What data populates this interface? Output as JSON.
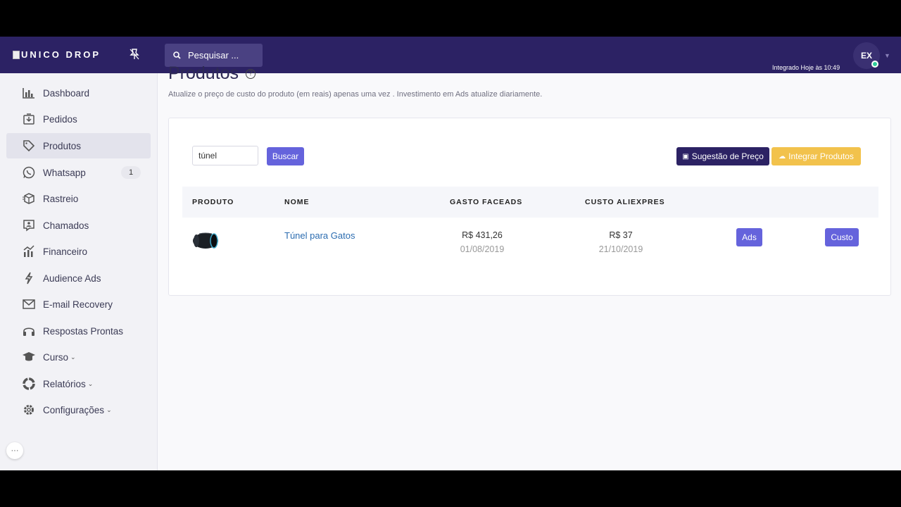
{
  "topbar": {
    "brand": "UNICO DROP",
    "search_placeholder": "Pesquisar ...",
    "integrado": "Integrado Hoje às 10:49",
    "avatar": "EX",
    "icons": {
      "pin": "pin-icon",
      "search": "search-icon",
      "caret": "chevron-down-icon"
    }
  },
  "sidebar": {
    "items": [
      {
        "label": "Dashboard",
        "icon": "bar-chart-icon"
      },
      {
        "label": "Pedidos",
        "icon": "inbox-icon"
      },
      {
        "label": "Produtos",
        "icon": "tag-icon",
        "active": true
      },
      {
        "label": "Whatsapp",
        "icon": "whatsapp-icon",
        "badge": "1"
      },
      {
        "label": "Rastreio",
        "icon": "package-icon"
      },
      {
        "label": "Chamados",
        "icon": "support-icon"
      },
      {
        "label": "Financeiro",
        "icon": "finance-chart-icon"
      },
      {
        "label": "Audience Ads",
        "icon": "bolt-icon"
      },
      {
        "label": "E-mail Recovery",
        "icon": "mail-icon"
      },
      {
        "label": "Respostas Prontas",
        "icon": "headset-icon"
      },
      {
        "label": "Curso",
        "icon": "graduation-cap-icon",
        "dropdown": true
      },
      {
        "label": "Relatórios",
        "icon": "pie-icon",
        "dropdown": true
      },
      {
        "label": "Configurações",
        "icon": "gear-icon",
        "dropdown": true
      }
    ],
    "more_label": "···"
  },
  "main": {
    "title": "Produtos",
    "help_icon": "?",
    "subtitle": "Atualize o preço de custo do produto (em reais) apenas uma vez . Investimento em Ads atualize diariamente.",
    "filter_value": "túnel",
    "buscar_label": "Buscar",
    "sugestao_label": "Sugestão de Preço",
    "integrar_label": "Integrar Produtos",
    "table": {
      "headers": [
        "PRODUTO",
        "NOME",
        "GASTO FACEADS",
        "CUSTO ALIEXPRES"
      ],
      "rows": [
        {
          "name": "Túnel para Gatos",
          "gasto": "R$ 431,26",
          "gasto_date": "01/08/2019",
          "custo": "R$ 37",
          "custo_date": "21/10/2019",
          "ads_label": "Ads",
          "custo_label": "Custo"
        }
      ]
    }
  },
  "colors": {
    "topbar": "#2c2264",
    "primary": "#6563dc",
    "warning": "#f2c24c",
    "link": "#2b6cb0"
  }
}
